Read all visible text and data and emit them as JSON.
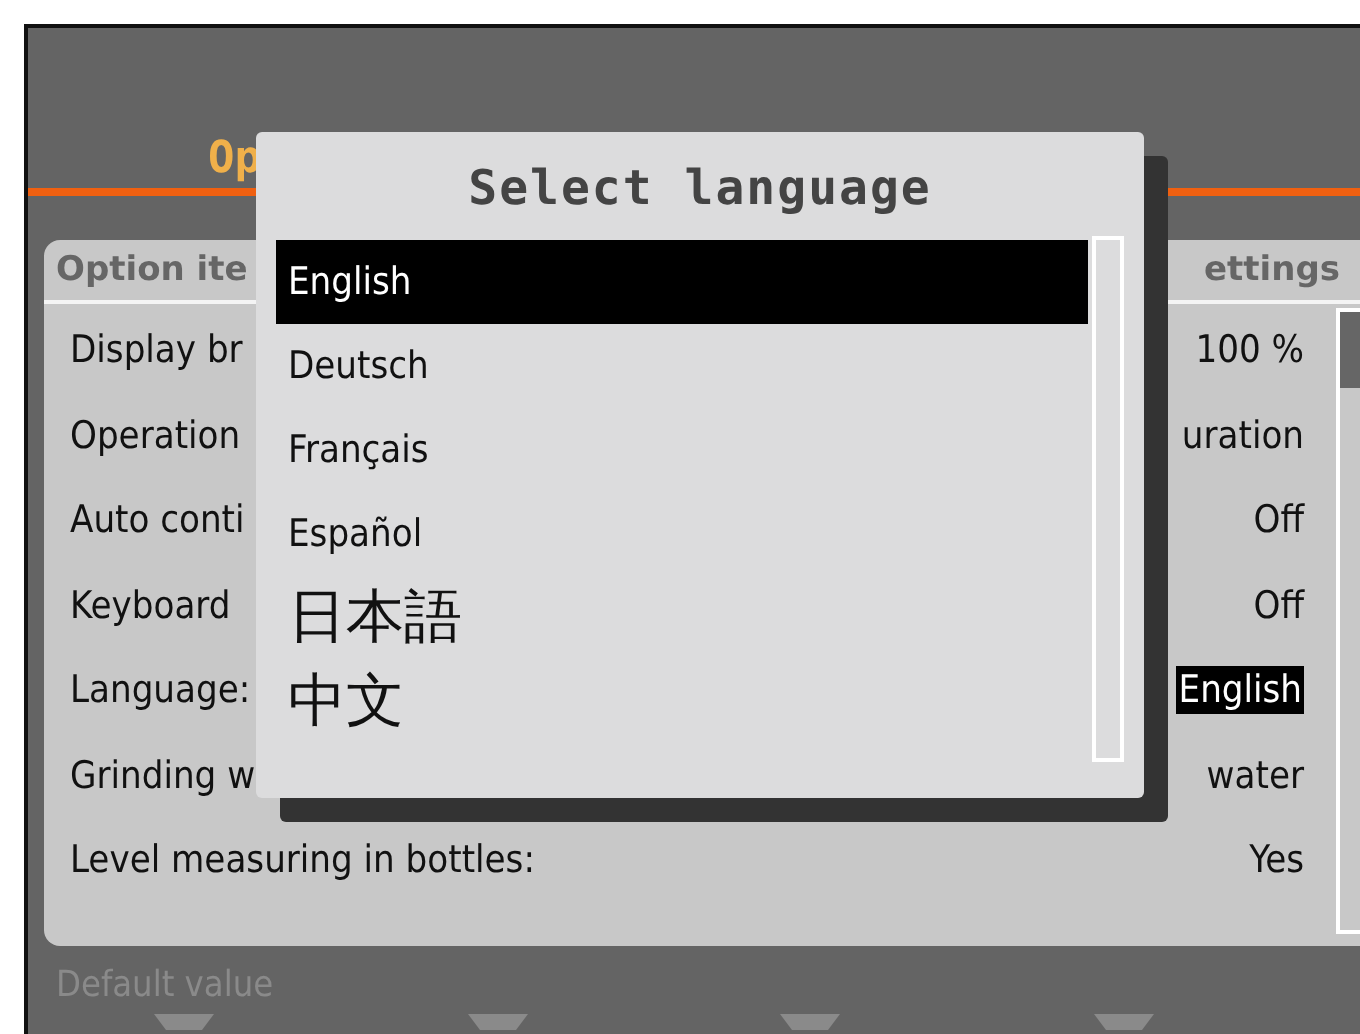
{
  "screen": {
    "title": "Op",
    "table": {
      "header_left": "Option ite",
      "header_right": "ettings",
      "rows": [
        {
          "label": "Display br",
          "value": "100 %",
          "selected": false
        },
        {
          "label": "Operation",
          "value": "uration",
          "selected": false
        },
        {
          "label": "Auto conti",
          "value": "Off",
          "selected": false
        },
        {
          "label": "Keyboard",
          "value": "Off",
          "selected": false
        },
        {
          "label": "Language:",
          "value": "English",
          "selected": true
        },
        {
          "label": "Grinding w",
          "value": "water",
          "selected": false
        },
        {
          "label": "Level measuring in bottles:",
          "value": "Yes",
          "selected": false
        }
      ]
    },
    "footer": "Default value"
  },
  "dialog": {
    "title": "Select language",
    "items": [
      {
        "label": "English",
        "selected": true,
        "kind": "latin"
      },
      {
        "label": "Deutsch",
        "selected": false,
        "kind": "latin"
      },
      {
        "label": "Français",
        "selected": false,
        "kind": "latin"
      },
      {
        "label": "Español",
        "selected": false,
        "kind": "latin"
      },
      {
        "label": "日本語",
        "selected": false,
        "kind": "cjk"
      },
      {
        "label": "中文",
        "selected": false,
        "kind": "cjk"
      }
    ]
  }
}
